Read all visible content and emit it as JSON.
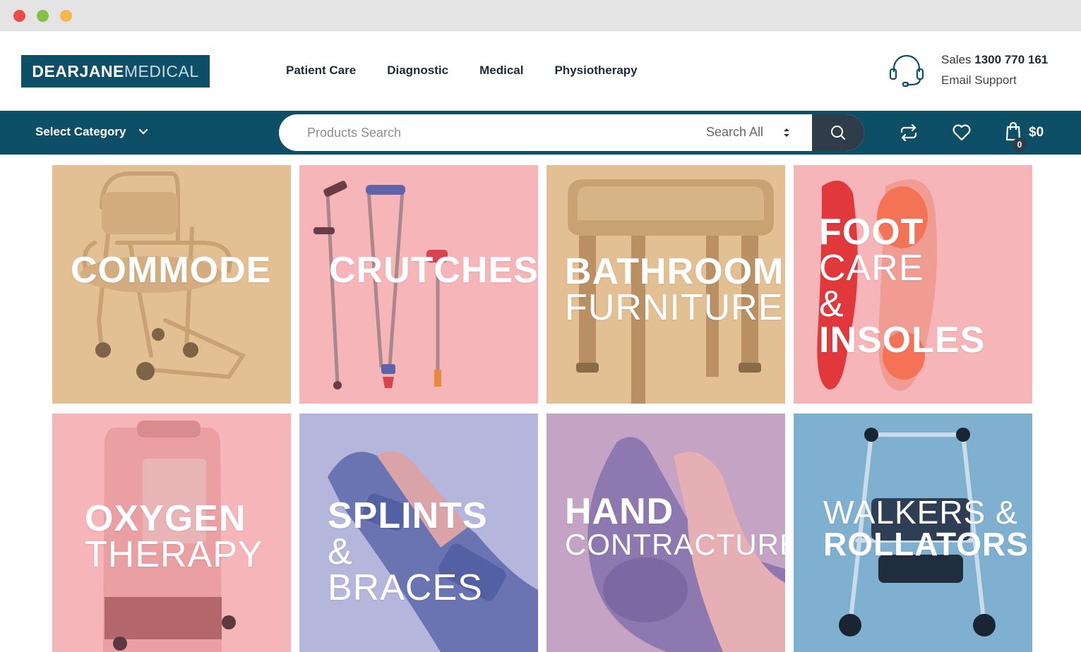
{
  "window": {
    "controls": [
      "close",
      "minimize",
      "zoom"
    ]
  },
  "logo": {
    "bold": "DEARJANE",
    "light": "MEDICAL"
  },
  "nav": [
    "Patient Care",
    "Diagnostic",
    "Medical",
    "Physiotherapy"
  ],
  "support": {
    "sales_label": "Sales",
    "sales_phone": "1300 770 161",
    "email_label": "Email Support",
    "icon": "headset-icon"
  },
  "toolbar": {
    "select_category": "Select Category",
    "search_placeholder": "Products Search",
    "search_scope": "Search All",
    "cart_total": "$0",
    "cart_count": "0"
  },
  "colors": {
    "brand": "#0d4f66",
    "dark": "#2f3d4a"
  },
  "categories": [
    {
      "name": "commode",
      "lines": [
        {
          "t": "COMMODE",
          "w": "b"
        }
      ],
      "color": "#e3bf94"
    },
    {
      "name": "crutches",
      "lines": [
        {
          "t": "CRUTCHES",
          "w": "b"
        }
      ],
      "color": "#f6b5b8"
    },
    {
      "name": "bathroom-furniture",
      "lines": [
        {
          "t": "BATHROOM",
          "w": "b"
        },
        {
          "t": "FURNITURE",
          "w": "l"
        }
      ],
      "color": "#e3bf94"
    },
    {
      "name": "foot-care",
      "lines": [
        {
          "t": "FOOT",
          "w": "b"
        },
        {
          "t": "CARE",
          "w": "l"
        },
        {
          "t": "&",
          "w": "l"
        },
        {
          "t": "INSOLES",
          "w": "b"
        }
      ],
      "color": "#f6b5b8"
    },
    {
      "name": "oxygen-therapy",
      "lines": [
        {
          "t": "OXYGEN",
          "w": "b"
        },
        {
          "t": "THERAPY",
          "w": "l"
        }
      ],
      "color": "#f6b5b8"
    },
    {
      "name": "splints",
      "lines": [
        {
          "t": "SPLINTS",
          "w": "b"
        },
        {
          "t": "&",
          "w": "l"
        },
        {
          "t": "BRACES",
          "w": "l"
        }
      ],
      "color": "#b4b6dc"
    },
    {
      "name": "hand-contracture",
      "lines": [
        {
          "t": "HAND",
          "w": "b"
        },
        {
          "t": "CONTRACTURE",
          "w": "l"
        }
      ],
      "color": "#c4a3c4"
    },
    {
      "name": "walkers",
      "lines": [
        {
          "t": "WALKERS &",
          "w": "l"
        },
        {
          "t": "ROLLATORS",
          "w": "b"
        }
      ],
      "color": "#7fb0cf"
    }
  ]
}
